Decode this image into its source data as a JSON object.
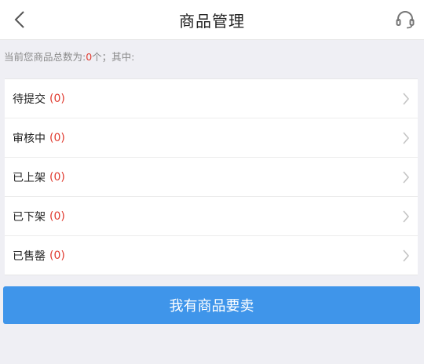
{
  "header": {
    "title": "商品管理",
    "back_icon": "chevron-left-icon",
    "service_icon": "headset-icon"
  },
  "summary": {
    "prefix": "当前您商品总数为:",
    "count": "0",
    "suffix": "个；其中:"
  },
  "status_items": [
    {
      "label": "待提交",
      "count": "(0)"
    },
    {
      "label": "审核中",
      "count": "(0)"
    },
    {
      "label": "已上架",
      "count": "(0)"
    },
    {
      "label": "已下架",
      "count": "(0)"
    },
    {
      "label": "已售罄",
      "count": "(0)"
    }
  ],
  "sell_button": {
    "label": "我有商品要卖"
  },
  "colors": {
    "accent": "#3f95ea",
    "count_red": "#e03a2f",
    "background": "#efeff4"
  }
}
